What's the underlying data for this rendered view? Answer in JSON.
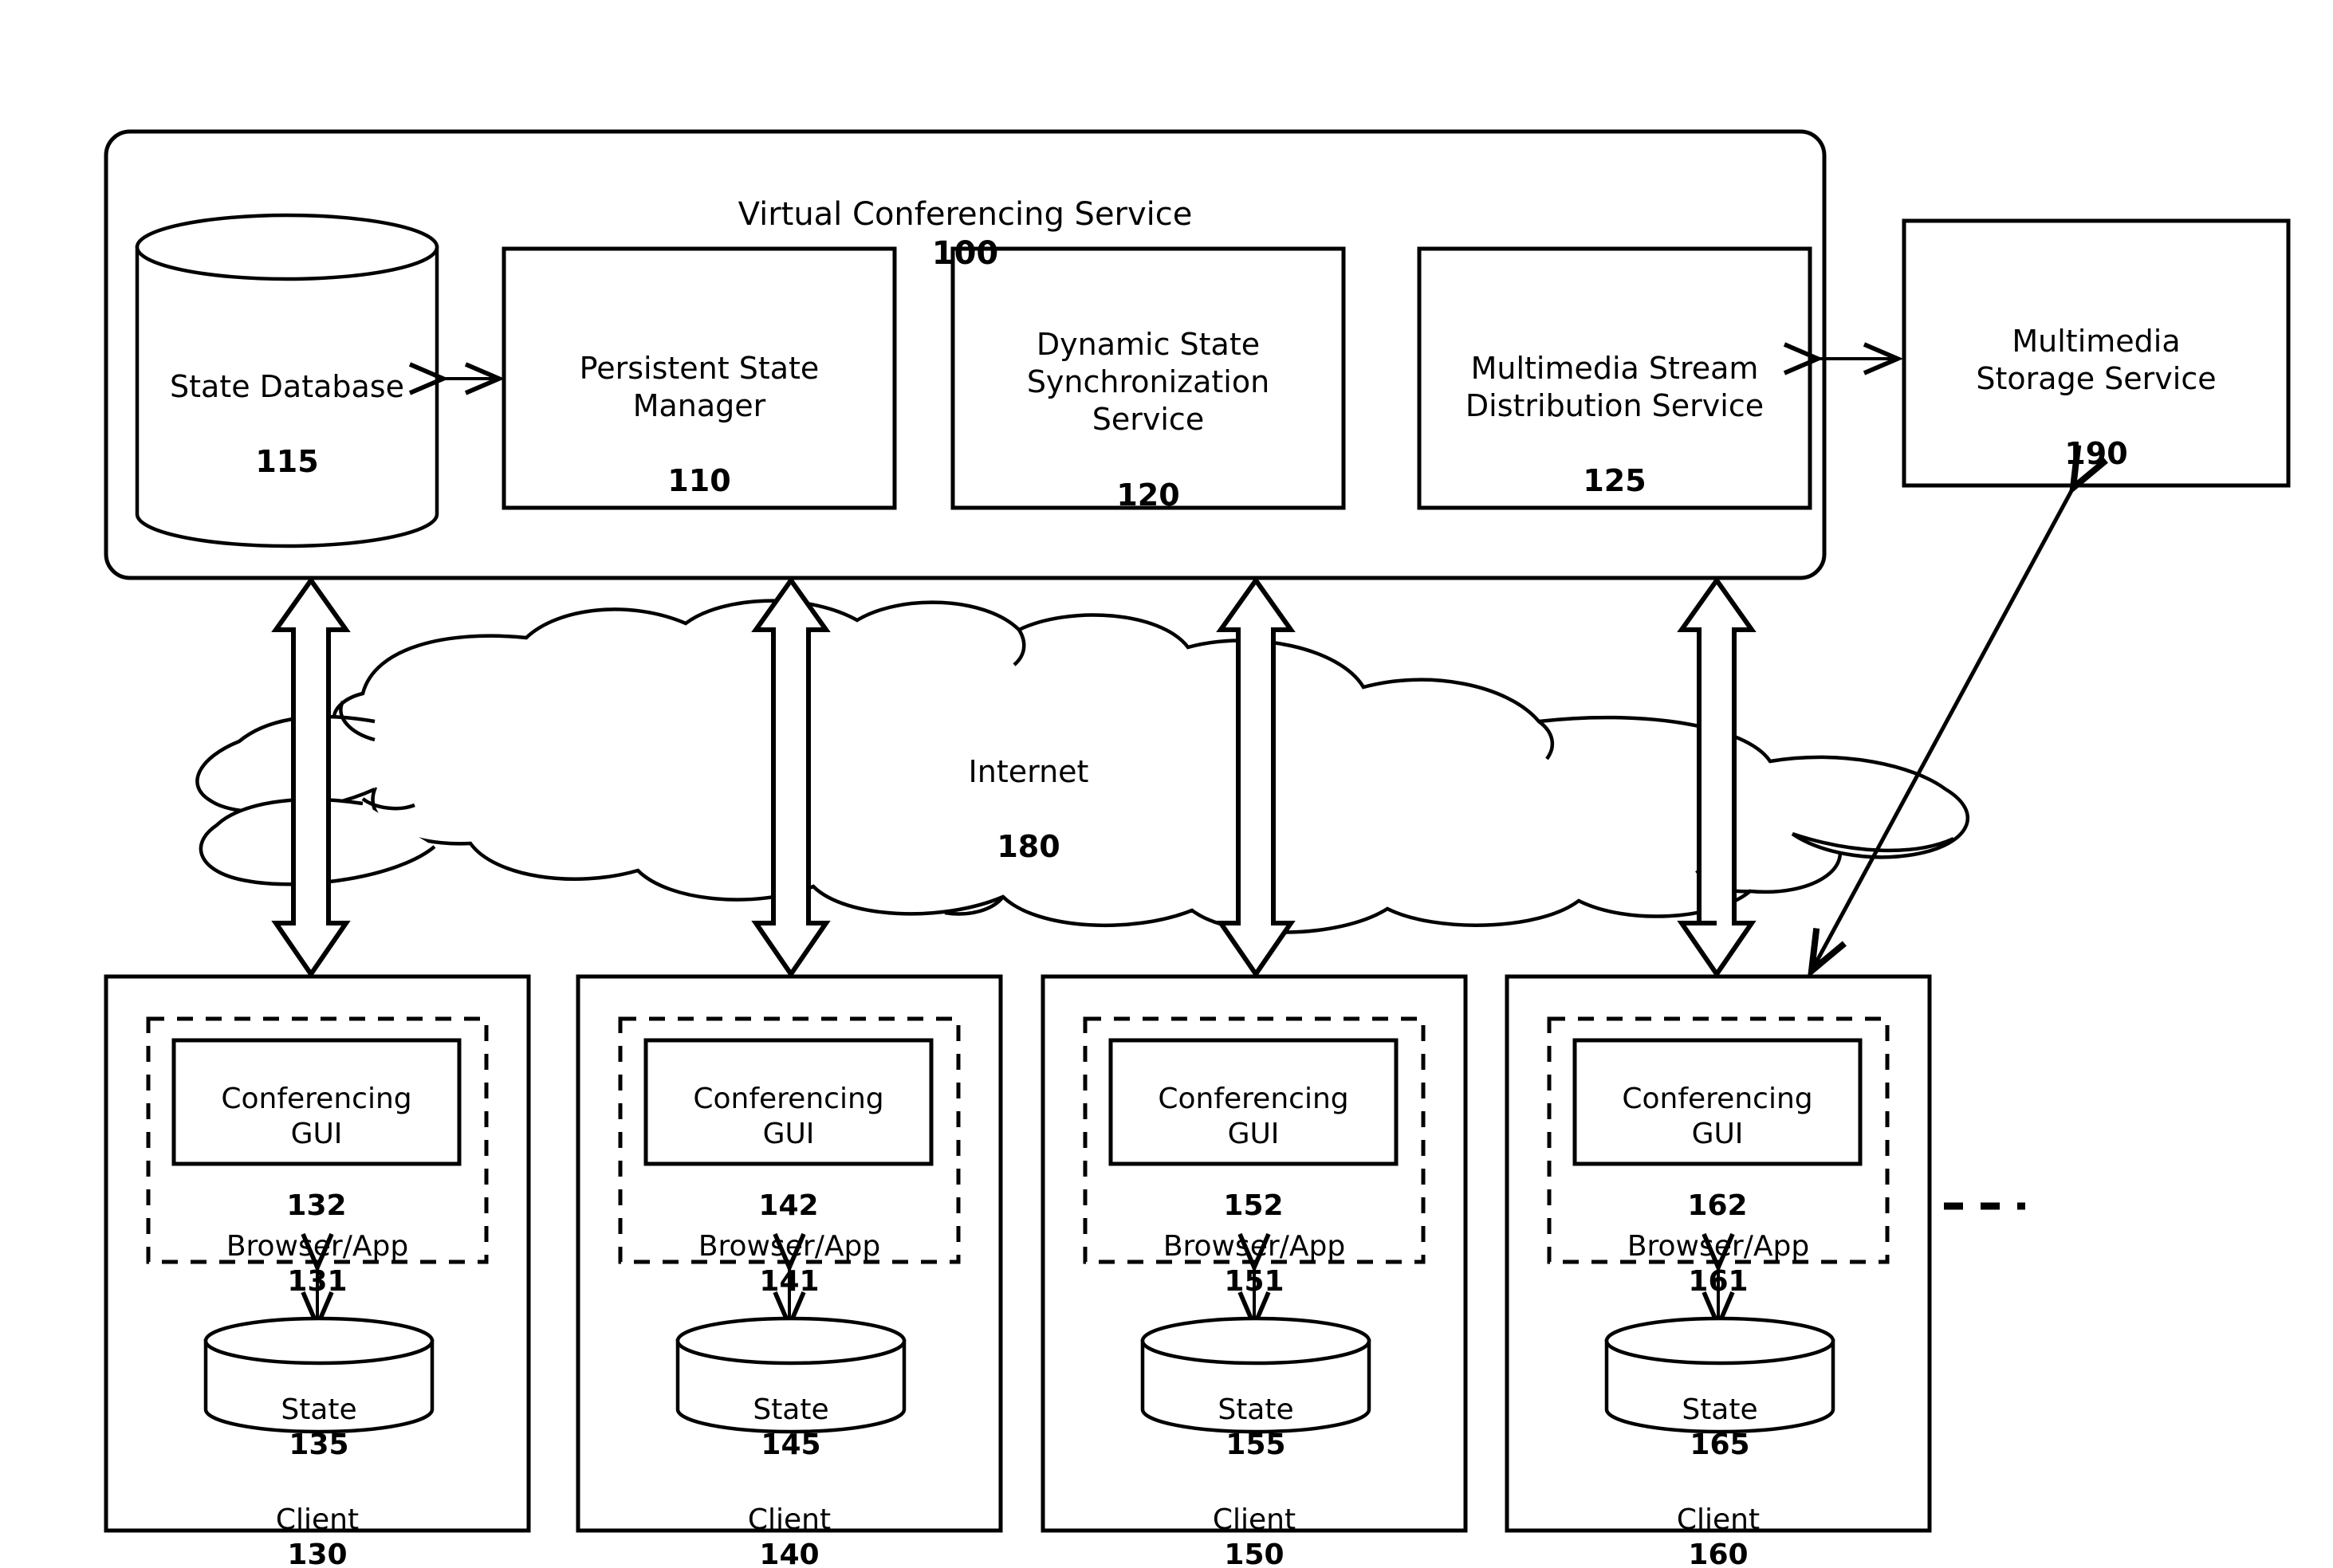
{
  "diagram": {
    "service_container": {
      "title_text": "Virtual Conferencing Service",
      "title_ref": "100"
    },
    "service_blocks": [
      {
        "name": "state-database",
        "label": "State Database",
        "ref": "115",
        "shape": "cylinder"
      },
      {
        "name": "persistent-state-manager",
        "label": "Persistent State\nManager",
        "ref": "110",
        "shape": "rect"
      },
      {
        "name": "dynamic-state-sync-service",
        "label": "Dynamic State\nSynchronization\nService",
        "ref": "120",
        "shape": "rect"
      },
      {
        "name": "multimedia-stream-distribution-service",
        "label": "Multimedia Stream\nDistribution Service",
        "ref": "125",
        "shape": "rect"
      }
    ],
    "external_blocks": [
      {
        "name": "multimedia-storage-service",
        "label": "Multimedia\nStorage Service",
        "ref": "190",
        "shape": "rect"
      }
    ],
    "network": {
      "label": "Internet",
      "ref": "180",
      "shape": "cloud"
    },
    "clients": [
      {
        "name": "client-130",
        "client_label": "Client",
        "client_ref": "130",
        "browser_label": "Browser/App",
        "browser_ref": "131",
        "gui_label": "Conferencing\nGUI",
        "gui_ref": "132",
        "state_label": "State",
        "state_ref": "135"
      },
      {
        "name": "client-140",
        "client_label": "Client",
        "client_ref": "140",
        "browser_label": "Browser/App",
        "browser_ref": "141",
        "gui_label": "Conferencing\nGUI",
        "gui_ref": "142",
        "state_label": "State",
        "state_ref": "145"
      },
      {
        "name": "client-150",
        "client_label": "Client",
        "client_ref": "150",
        "browser_label": "Browser/App",
        "browser_ref": "151",
        "gui_label": "Conferencing\nGUI",
        "gui_ref": "152",
        "state_label": "State",
        "state_ref": "155"
      },
      {
        "name": "client-160",
        "client_label": "Client",
        "client_ref": "160",
        "browser_label": "Browser/App",
        "browser_ref": "161",
        "gui_label": "Conferencing\nGUI",
        "gui_ref": "162",
        "state_label": "State",
        "state_ref": "165"
      }
    ],
    "connectors": [
      {
        "name": "db-to-psm-arrow",
        "kind": "double-headed-line",
        "orientation": "horizontal"
      },
      {
        "name": "msds-to-storage-arrow",
        "kind": "double-headed-line",
        "orientation": "horizontal"
      },
      {
        "name": "service-to-client-130-arrow",
        "kind": "double-headed-block",
        "orientation": "vertical"
      },
      {
        "name": "service-to-client-140-arrow",
        "kind": "double-headed-block",
        "orientation": "vertical"
      },
      {
        "name": "service-to-client-150-arrow",
        "kind": "double-headed-block",
        "orientation": "vertical"
      },
      {
        "name": "service-to-client-160-arrow",
        "kind": "double-headed-block",
        "orientation": "vertical"
      },
      {
        "name": "storage-to-client-160-arrow",
        "kind": "double-headed-line",
        "orientation": "diagonal"
      },
      {
        "name": "browser-131-to-state-135-arrow",
        "kind": "double-headed-line",
        "orientation": "vertical"
      },
      {
        "name": "browser-141-to-state-145-arrow",
        "kind": "double-headed-line",
        "orientation": "vertical"
      },
      {
        "name": "browser-151-to-state-155-arrow",
        "kind": "double-headed-line",
        "orientation": "vertical"
      },
      {
        "name": "browser-161-to-state-165-arrow",
        "kind": "double-headed-line",
        "orientation": "vertical"
      },
      {
        "name": "more-clients-ellipsis",
        "kind": "dashed-continuation",
        "orientation": "horizontal"
      }
    ],
    "colors": {
      "stroke": "#000000",
      "fill": "#ffffff",
      "background": "#ffffff"
    }
  }
}
